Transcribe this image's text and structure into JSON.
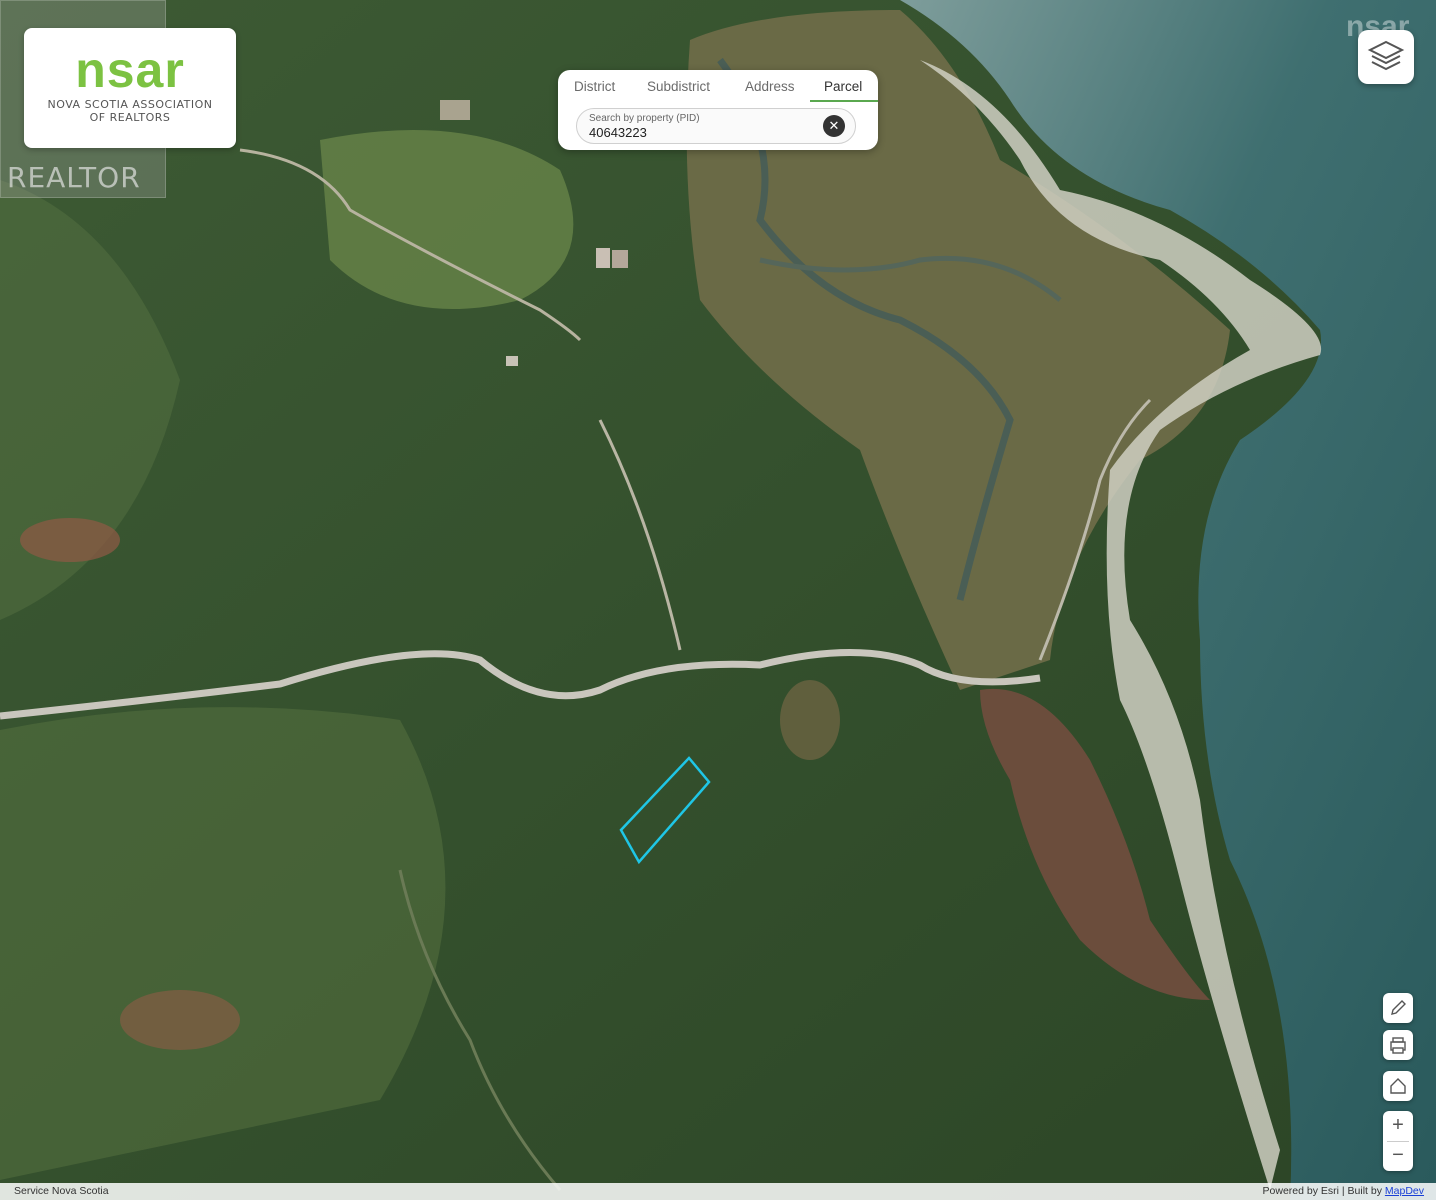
{
  "branding": {
    "logo_word": "nsar",
    "logo_line1": "NOVA SCOTIA ASSOCIATION",
    "logo_line2": "OF REALTORS",
    "realtor_mark": "REALTOR",
    "watermark": "nsar"
  },
  "search": {
    "tabs": [
      "District",
      "Subdistrict",
      "Address",
      "Parcel"
    ],
    "active_tab": "Parcel",
    "placeholder": "Search by property (PID)",
    "value": "40643223",
    "clear_icon": "close-circle-icon"
  },
  "controls": {
    "layers_icon": "layers-icon",
    "edit_icon": "pencil-icon",
    "print_icon": "printer-icon",
    "home_icon": "home-icon",
    "zoom_in": "+",
    "zoom_out": "−"
  },
  "map": {
    "basemap": "satellite imagery",
    "parcel_outline_color": "#1fc6e6"
  },
  "footer": {
    "attribution_left": "Service Nova Scotia",
    "attribution_right_prefix": "Powered by Esri | Built by",
    "attribution_link": "MapDev"
  }
}
